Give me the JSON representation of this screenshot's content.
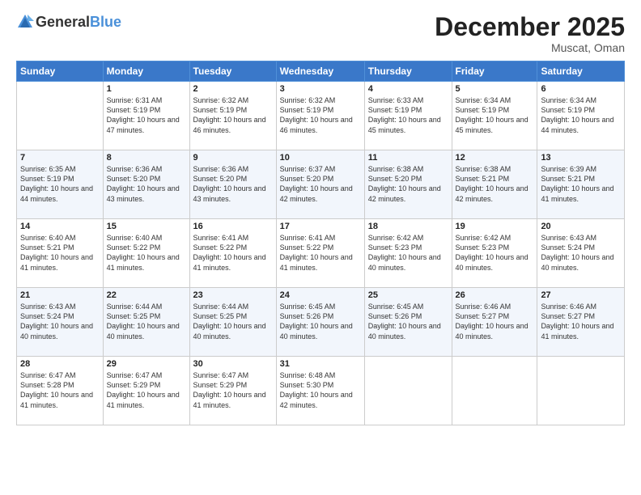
{
  "header": {
    "logo_general": "General",
    "logo_blue": "Blue",
    "month_title": "December 2025",
    "location": "Muscat, Oman"
  },
  "days_of_week": [
    "Sunday",
    "Monday",
    "Tuesday",
    "Wednesday",
    "Thursday",
    "Friday",
    "Saturday"
  ],
  "weeks": [
    [
      {
        "day": "",
        "sunrise": "",
        "sunset": "",
        "daylight": ""
      },
      {
        "day": "1",
        "sunrise": "Sunrise: 6:31 AM",
        "sunset": "Sunset: 5:19 PM",
        "daylight": "Daylight: 10 hours and 47 minutes."
      },
      {
        "day": "2",
        "sunrise": "Sunrise: 6:32 AM",
        "sunset": "Sunset: 5:19 PM",
        "daylight": "Daylight: 10 hours and 46 minutes."
      },
      {
        "day": "3",
        "sunrise": "Sunrise: 6:32 AM",
        "sunset": "Sunset: 5:19 PM",
        "daylight": "Daylight: 10 hours and 46 minutes."
      },
      {
        "day": "4",
        "sunrise": "Sunrise: 6:33 AM",
        "sunset": "Sunset: 5:19 PM",
        "daylight": "Daylight: 10 hours and 45 minutes."
      },
      {
        "day": "5",
        "sunrise": "Sunrise: 6:34 AM",
        "sunset": "Sunset: 5:19 PM",
        "daylight": "Daylight: 10 hours and 45 minutes."
      },
      {
        "day": "6",
        "sunrise": "Sunrise: 6:34 AM",
        "sunset": "Sunset: 5:19 PM",
        "daylight": "Daylight: 10 hours and 44 minutes."
      }
    ],
    [
      {
        "day": "7",
        "sunrise": "Sunrise: 6:35 AM",
        "sunset": "Sunset: 5:19 PM",
        "daylight": "Daylight: 10 hours and 44 minutes."
      },
      {
        "day": "8",
        "sunrise": "Sunrise: 6:36 AM",
        "sunset": "Sunset: 5:20 PM",
        "daylight": "Daylight: 10 hours and 43 minutes."
      },
      {
        "day": "9",
        "sunrise": "Sunrise: 6:36 AM",
        "sunset": "Sunset: 5:20 PM",
        "daylight": "Daylight: 10 hours and 43 minutes."
      },
      {
        "day": "10",
        "sunrise": "Sunrise: 6:37 AM",
        "sunset": "Sunset: 5:20 PM",
        "daylight": "Daylight: 10 hours and 42 minutes."
      },
      {
        "day": "11",
        "sunrise": "Sunrise: 6:38 AM",
        "sunset": "Sunset: 5:20 PM",
        "daylight": "Daylight: 10 hours and 42 minutes."
      },
      {
        "day": "12",
        "sunrise": "Sunrise: 6:38 AM",
        "sunset": "Sunset: 5:21 PM",
        "daylight": "Daylight: 10 hours and 42 minutes."
      },
      {
        "day": "13",
        "sunrise": "Sunrise: 6:39 AM",
        "sunset": "Sunset: 5:21 PM",
        "daylight": "Daylight: 10 hours and 41 minutes."
      }
    ],
    [
      {
        "day": "14",
        "sunrise": "Sunrise: 6:40 AM",
        "sunset": "Sunset: 5:21 PM",
        "daylight": "Daylight: 10 hours and 41 minutes."
      },
      {
        "day": "15",
        "sunrise": "Sunrise: 6:40 AM",
        "sunset": "Sunset: 5:22 PM",
        "daylight": "Daylight: 10 hours and 41 minutes."
      },
      {
        "day": "16",
        "sunrise": "Sunrise: 6:41 AM",
        "sunset": "Sunset: 5:22 PM",
        "daylight": "Daylight: 10 hours and 41 minutes."
      },
      {
        "day": "17",
        "sunrise": "Sunrise: 6:41 AM",
        "sunset": "Sunset: 5:22 PM",
        "daylight": "Daylight: 10 hours and 41 minutes."
      },
      {
        "day": "18",
        "sunrise": "Sunrise: 6:42 AM",
        "sunset": "Sunset: 5:23 PM",
        "daylight": "Daylight: 10 hours and 40 minutes."
      },
      {
        "day": "19",
        "sunrise": "Sunrise: 6:42 AM",
        "sunset": "Sunset: 5:23 PM",
        "daylight": "Daylight: 10 hours and 40 minutes."
      },
      {
        "day": "20",
        "sunrise": "Sunrise: 6:43 AM",
        "sunset": "Sunset: 5:24 PM",
        "daylight": "Daylight: 10 hours and 40 minutes."
      }
    ],
    [
      {
        "day": "21",
        "sunrise": "Sunrise: 6:43 AM",
        "sunset": "Sunset: 5:24 PM",
        "daylight": "Daylight: 10 hours and 40 minutes."
      },
      {
        "day": "22",
        "sunrise": "Sunrise: 6:44 AM",
        "sunset": "Sunset: 5:25 PM",
        "daylight": "Daylight: 10 hours and 40 minutes."
      },
      {
        "day": "23",
        "sunrise": "Sunrise: 6:44 AM",
        "sunset": "Sunset: 5:25 PM",
        "daylight": "Daylight: 10 hours and 40 minutes."
      },
      {
        "day": "24",
        "sunrise": "Sunrise: 6:45 AM",
        "sunset": "Sunset: 5:26 PM",
        "daylight": "Daylight: 10 hours and 40 minutes."
      },
      {
        "day": "25",
        "sunrise": "Sunrise: 6:45 AM",
        "sunset": "Sunset: 5:26 PM",
        "daylight": "Daylight: 10 hours and 40 minutes."
      },
      {
        "day": "26",
        "sunrise": "Sunrise: 6:46 AM",
        "sunset": "Sunset: 5:27 PM",
        "daylight": "Daylight: 10 hours and 40 minutes."
      },
      {
        "day": "27",
        "sunrise": "Sunrise: 6:46 AM",
        "sunset": "Sunset: 5:27 PM",
        "daylight": "Daylight: 10 hours and 41 minutes."
      }
    ],
    [
      {
        "day": "28",
        "sunrise": "Sunrise: 6:47 AM",
        "sunset": "Sunset: 5:28 PM",
        "daylight": "Daylight: 10 hours and 41 minutes."
      },
      {
        "day": "29",
        "sunrise": "Sunrise: 6:47 AM",
        "sunset": "Sunset: 5:29 PM",
        "daylight": "Daylight: 10 hours and 41 minutes."
      },
      {
        "day": "30",
        "sunrise": "Sunrise: 6:47 AM",
        "sunset": "Sunset: 5:29 PM",
        "daylight": "Daylight: 10 hours and 41 minutes."
      },
      {
        "day": "31",
        "sunrise": "Sunrise: 6:48 AM",
        "sunset": "Sunset: 5:30 PM",
        "daylight": "Daylight: 10 hours and 42 minutes."
      },
      {
        "day": "",
        "sunrise": "",
        "sunset": "",
        "daylight": ""
      },
      {
        "day": "",
        "sunrise": "",
        "sunset": "",
        "daylight": ""
      },
      {
        "day": "",
        "sunrise": "",
        "sunset": "",
        "daylight": ""
      }
    ]
  ]
}
